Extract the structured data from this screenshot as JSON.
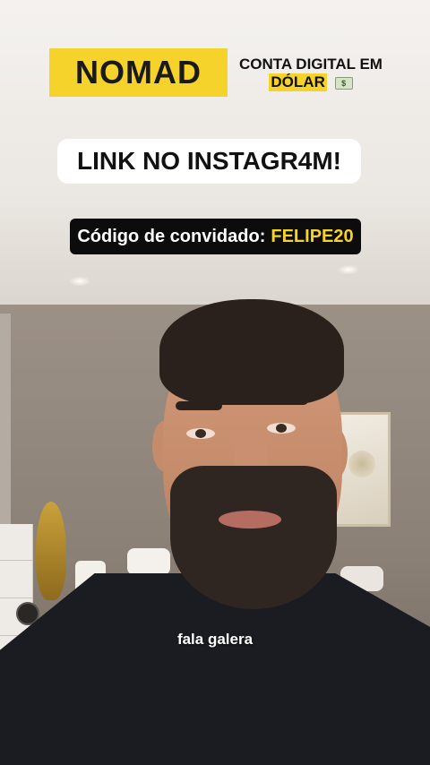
{
  "brand": {
    "logo_text": "NOMAD",
    "logo_mark": "N",
    "color": "#f5d32a"
  },
  "promo": {
    "line1": "CONTA DIGITAL EM",
    "line2": "DÓLAR",
    "icon": "money-bill-icon"
  },
  "banner": {
    "text": "LINK NO INSTAGR4M!"
  },
  "invite": {
    "label": "Código de convidado:",
    "code": "FELIPE20"
  },
  "caption": {
    "text": "fala galera"
  }
}
